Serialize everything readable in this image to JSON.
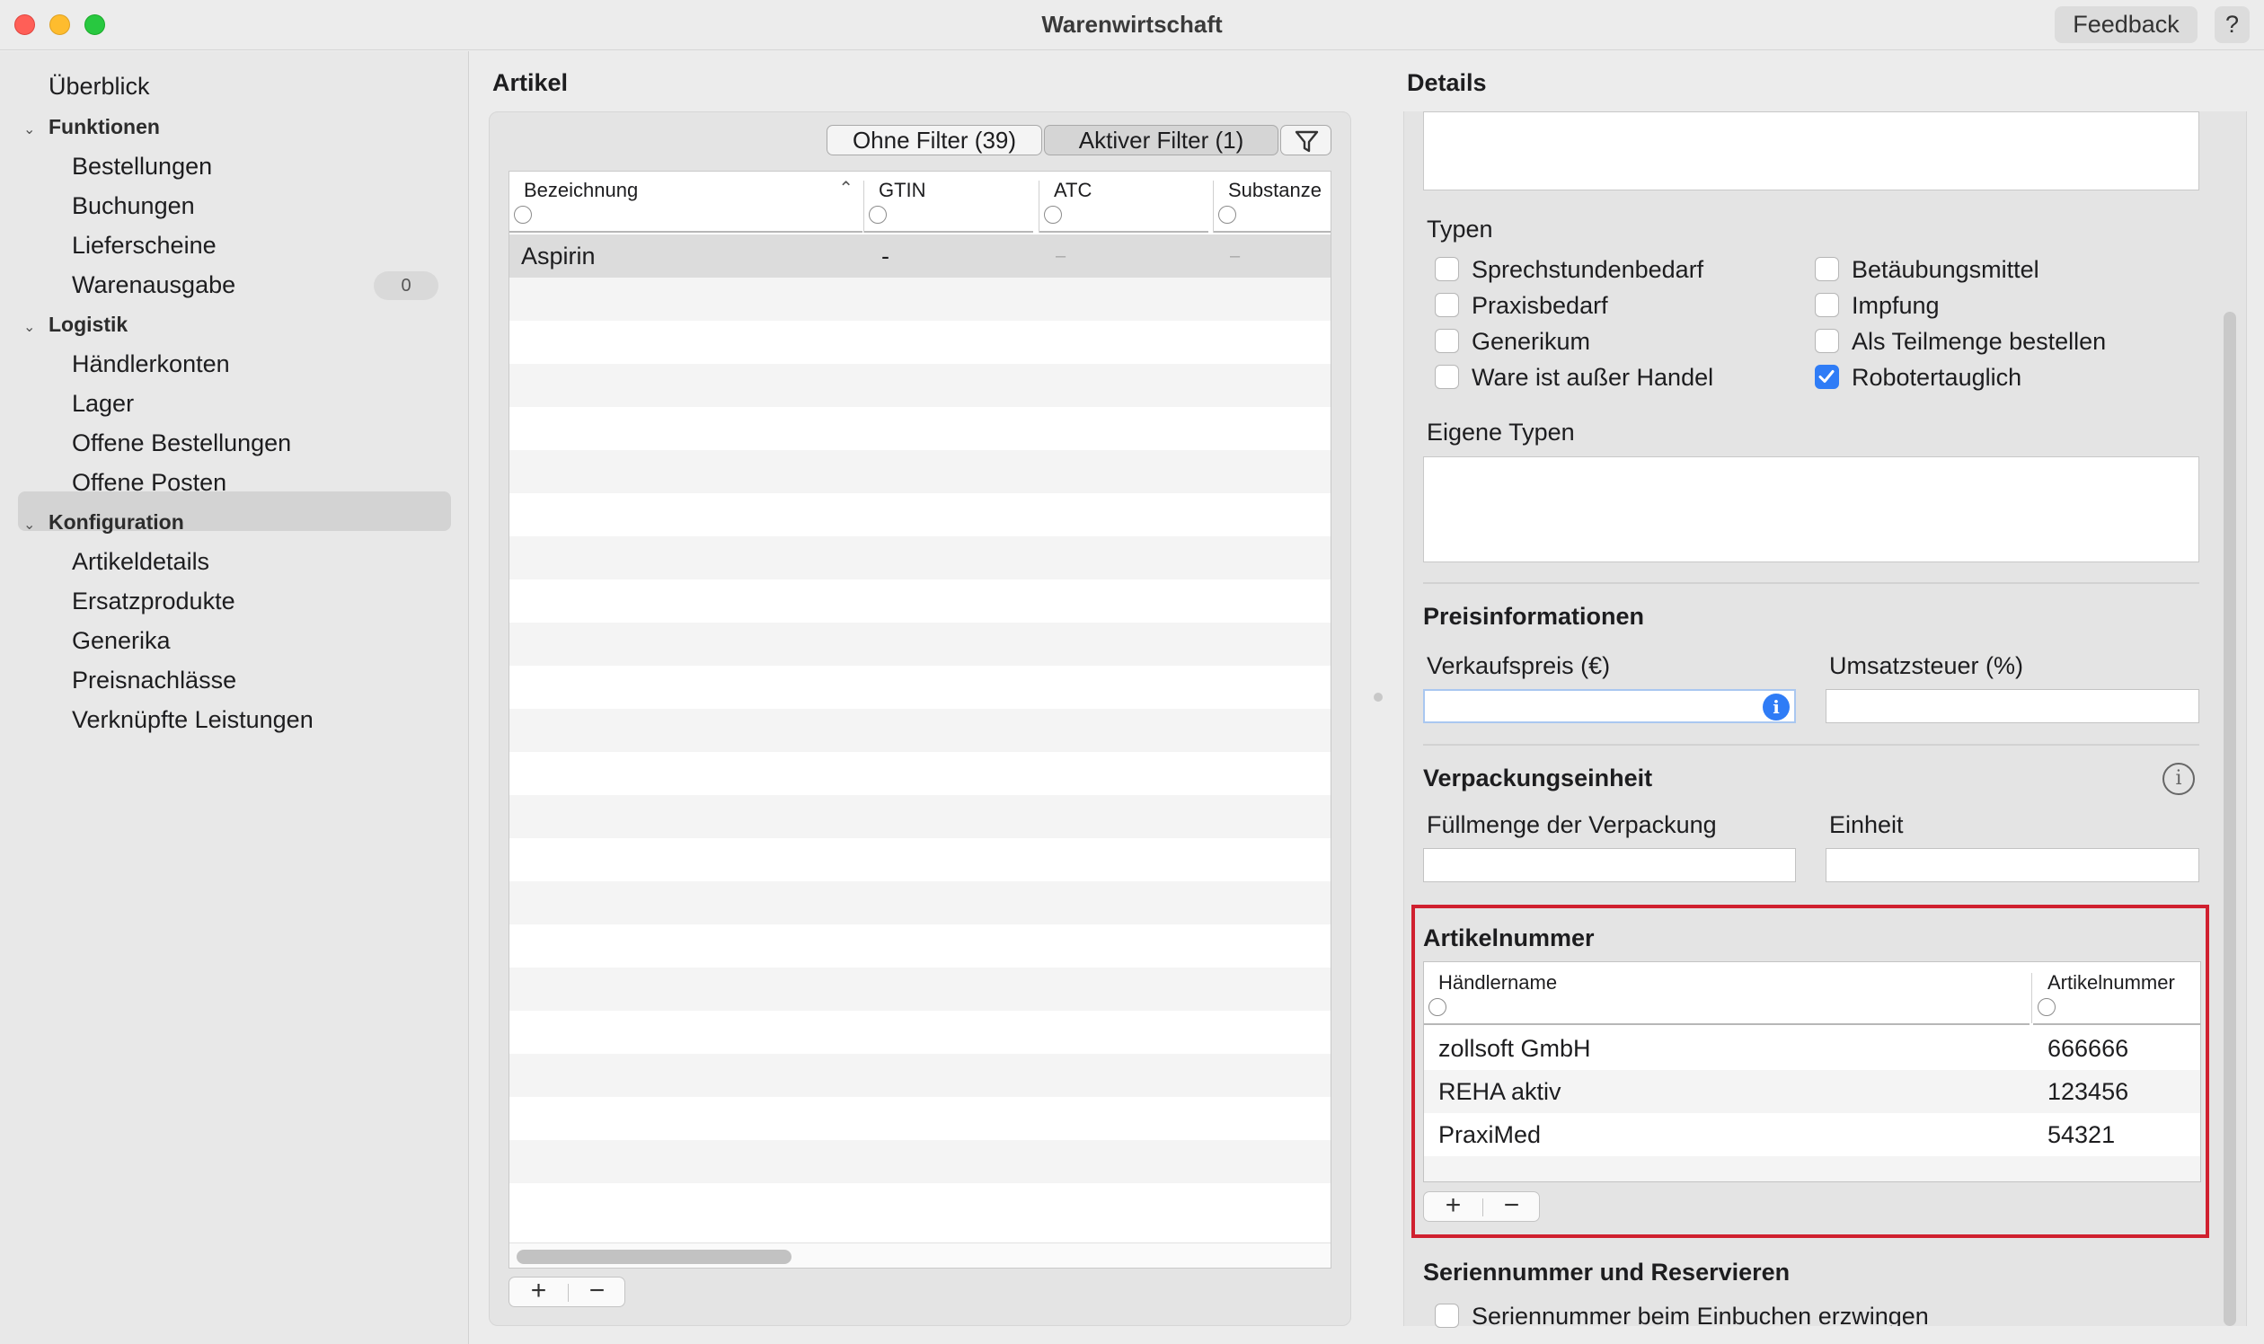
{
  "window": {
    "title": "Warenwirtschaft",
    "feedback_label": "Feedback",
    "help_label": "?"
  },
  "sidebar": {
    "overview": "Überblick",
    "sections": [
      {
        "label": "Funktionen",
        "items": [
          "Bestellungen",
          "Buchungen",
          "Lieferscheine",
          "Warenausgabe"
        ]
      },
      {
        "label": "Logistik",
        "items": [
          "Händlerkonten",
          "Lager",
          "Offene Bestellungen",
          "Offene Posten"
        ]
      },
      {
        "label": "Konfiguration",
        "items": [
          "Artikeldetails",
          "Ersatzprodukte",
          "Generika",
          "Preisnachlässe",
          "Verknüpfte Leistungen"
        ]
      }
    ],
    "warenausgabe_badge": "0",
    "selected": "Artikeldetails"
  },
  "artikel": {
    "title": "Artikel",
    "filter_none": "Ohne Filter (39)",
    "filter_active": "Aktiver Filter (1)",
    "columns": [
      "Bezeichnung",
      "GTIN",
      "ATC",
      "Substanze"
    ],
    "rows": [
      {
        "bezeichnung": "Aspirin",
        "gtin": "-",
        "atc": "–",
        "substanz": "–"
      }
    ],
    "add_label": "+",
    "remove_label": "−"
  },
  "details": {
    "title": "Details",
    "typen_label": "Typen",
    "typen": [
      {
        "label": "Sprechstundenbedarf",
        "checked": false
      },
      {
        "label": "Praxisbedarf",
        "checked": false
      },
      {
        "label": "Generikum",
        "checked": false
      },
      {
        "label": "Ware ist außer Handel",
        "checked": false
      },
      {
        "label": "Betäubungsmittel",
        "checked": false
      },
      {
        "label": "Impfung",
        "checked": false
      },
      {
        "label": "Als Teilmenge bestellen",
        "checked": false
      },
      {
        "label": "Robotertauglich",
        "checked": true
      }
    ],
    "eigene_typen_label": "Eigene Typen",
    "preis_heading": "Preisinformationen",
    "verkaufspreis_label": "Verkaufspreis (€)",
    "verkaufspreis_value": "",
    "umsatzsteuer_label": "Umsatzsteuer (%)",
    "umsatzsteuer_value": "",
    "verpackung_heading": "Verpackungseinheit",
    "fuellmenge_label": "Füllmenge der Verpackung",
    "einheit_label": "Einheit",
    "artikelnummer_heading": "Artikelnummer",
    "artikelnummer_columns": [
      "Händlername",
      "Artikelnummer"
    ],
    "artikelnummer_rows": [
      {
        "haendler": "zollsoft GmbH",
        "nummer": "666666"
      },
      {
        "haendler": "REHA aktiv",
        "nummer": "123456"
      },
      {
        "haendler": "PraxiMed",
        "nummer": "54321"
      }
    ],
    "serien_heading": "Seriennummer und Reservieren",
    "serien_checkbox": "Seriennummer beim Einbuchen erzwingen",
    "add_label": "+",
    "remove_label": "−",
    "info_glyph": "i"
  },
  "colors": {
    "accent": "#2f7cf6",
    "highlight": "#d0202f"
  }
}
